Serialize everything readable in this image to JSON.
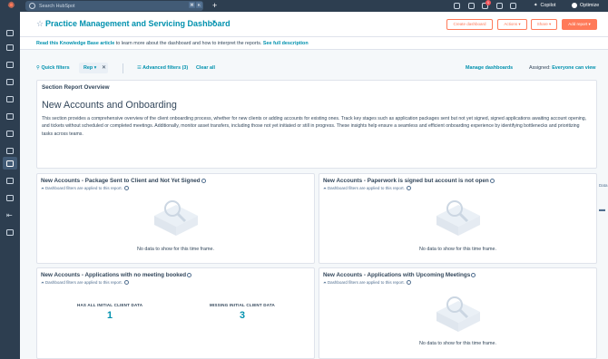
{
  "topbar": {
    "search_placeholder": "Search HubSpot",
    "kbd1": "⌘",
    "kbd2": "K",
    "notification_count": "1",
    "copilot_label": "Copilot",
    "user_label": "Optimize"
  },
  "header": {
    "title": "Practice Management and Servicing Dashboard",
    "create_dashboard": "Create dashboard",
    "actions": "Actions",
    "share": "Share",
    "add_report": "Add report"
  },
  "kb": {
    "link1": "Read this Knowledge Base article",
    "middle": " to learn more about the dashboard and how to interpret the reports. ",
    "link2": "See full description"
  },
  "filters": {
    "quick_filters": "Quick filters",
    "rep_filter": "Rep",
    "advanced_filters": "Advanced filters (3)",
    "clear_all": "Clear all",
    "manage_dashboards": "Manage dashboards",
    "assigned_label": "Assigned:",
    "assigned_value": "Everyone can view"
  },
  "overview": {
    "header": "Section Report Overview",
    "title": "New Accounts and Onboarding",
    "body": "This section provides a comprehensive overview of the client onboarding process, whether for new clients or adding accounts for existing ones. Track key stages such as application packages sent but not yet signed, signed applications awaiting account opening, and tickets without scheduled or completed meetings. Additionally, monitor asset transfers, including those not yet initiated or still in progress. These insights help ensure a seamless and efficient onboarding experience by identifying bottlenecks and prioritizing tasks across teams."
  },
  "reports": [
    {
      "title": "New Accounts - Package Sent to Client and Not Yet Signed",
      "subtitle": "Dashboard filters are applied to this report.",
      "empty": "No data to show for this time frame."
    },
    {
      "title": "New Accounts - Paperwork is signed but account is not open",
      "subtitle": "Dashboard filters are applied to this report.",
      "empty": "No data to show for this time frame."
    },
    {
      "title": "New Accounts - Applications with no meeting booked",
      "subtitle": "Dashboard filters are applied to this report.",
      "kpis": [
        {
          "label": "HAS ALL INITIAL CLIENT DATA",
          "value": "1"
        },
        {
          "label": "MISSING INITIAL CLIENT DATA",
          "value": "3"
        }
      ]
    },
    {
      "title": "New Accounts - Applications with Upcoming Meetings",
      "subtitle": "Dashboard filters are applied to this report.",
      "empty": "No data to show for this time frame."
    }
  ],
  "right_tabs": {
    "tab1": "Data"
  },
  "colors": {
    "accent": "#ff7a59",
    "link": "#0091ae",
    "nav": "#2d3e50"
  }
}
